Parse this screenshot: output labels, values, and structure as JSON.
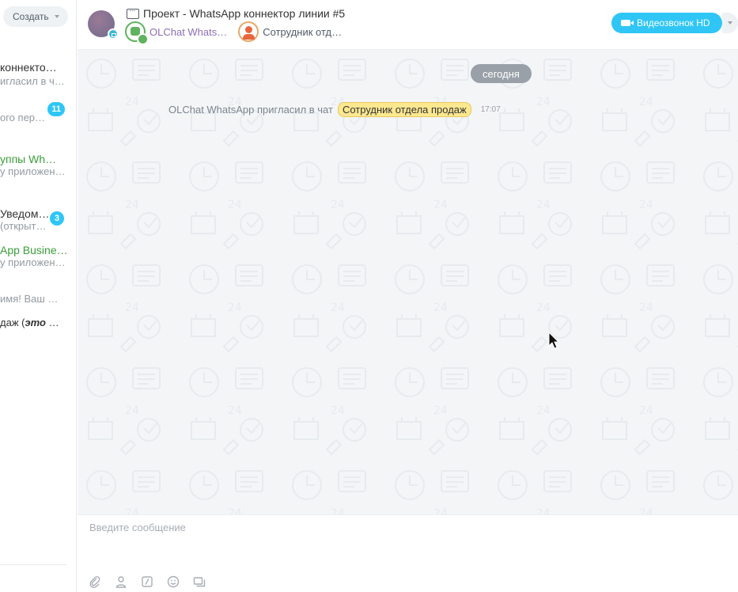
{
  "sidebar": {
    "create_label": "Создать",
    "items": [
      {
        "title": " коннекто…",
        "preview": "игласил в ч…",
        "badge": ""
      },
      {
        "title": "",
        "preview": "ого пер…",
        "badge": "11"
      },
      {
        "title": "уппы Wh…",
        "preview": "у приложен…",
        "badge": ""
      },
      {
        "title": "Уведом…",
        "preview": "(открыт…",
        "badge": "3"
      },
      {
        "title": "App Busine…",
        "preview": "у приложен…",
        "badge": ""
      },
      {
        "title": "",
        "preview": " имя! Ваш …",
        "badge": ""
      },
      {
        "title": "",
        "preview_prefix": "даж (",
        "preview_bold": "это",
        "preview_suffix": " …",
        "badge": ""
      }
    ]
  },
  "header": {
    "title": "Проект - WhatsApp коннектор линии #5",
    "members": [
      {
        "name": "OLChat Whats…",
        "icon": "bot-avatar-icon"
      },
      {
        "name": "Сотрудник отд…",
        "icon": "user-avatar-icon"
      }
    ],
    "video_label": "Видеозвонок HD"
  },
  "messages": {
    "date_label": "сегодня",
    "system_message": {
      "text": "OLChat WhatsApp пригласил в чат",
      "mention": "Сотрудник отдела продаж",
      "time": "17:07"
    }
  },
  "composer": {
    "placeholder": "Введите сообщение",
    "tools": [
      "paperclip-icon",
      "user-icon",
      "slash-command-icon",
      "smile-icon",
      "chat-history-icon"
    ]
  },
  "colors": {
    "accent": "#2fc6f6",
    "date_pill": "#9aa0a8",
    "mention_bg": "#fde88f",
    "green_text": "#3b9e3b"
  }
}
